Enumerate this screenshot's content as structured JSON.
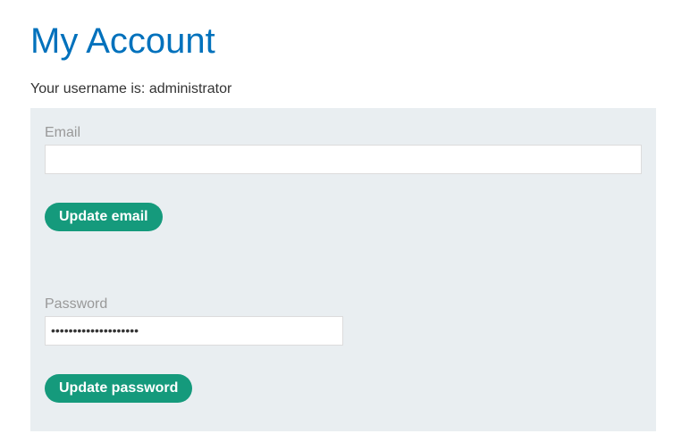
{
  "page": {
    "title": "My Account",
    "username_line": "Your username is: administrator"
  },
  "email_form": {
    "label": "Email",
    "value": "",
    "button_label": "Update email"
  },
  "password_form": {
    "label": "Password",
    "value": "••••••••••••••••••••",
    "button_label": "Update password"
  },
  "colors": {
    "title": "#0071bc",
    "panel_background": "#e9eef1",
    "button_background": "#159a7c",
    "button_text": "#ffffff",
    "label_text": "#999999"
  }
}
